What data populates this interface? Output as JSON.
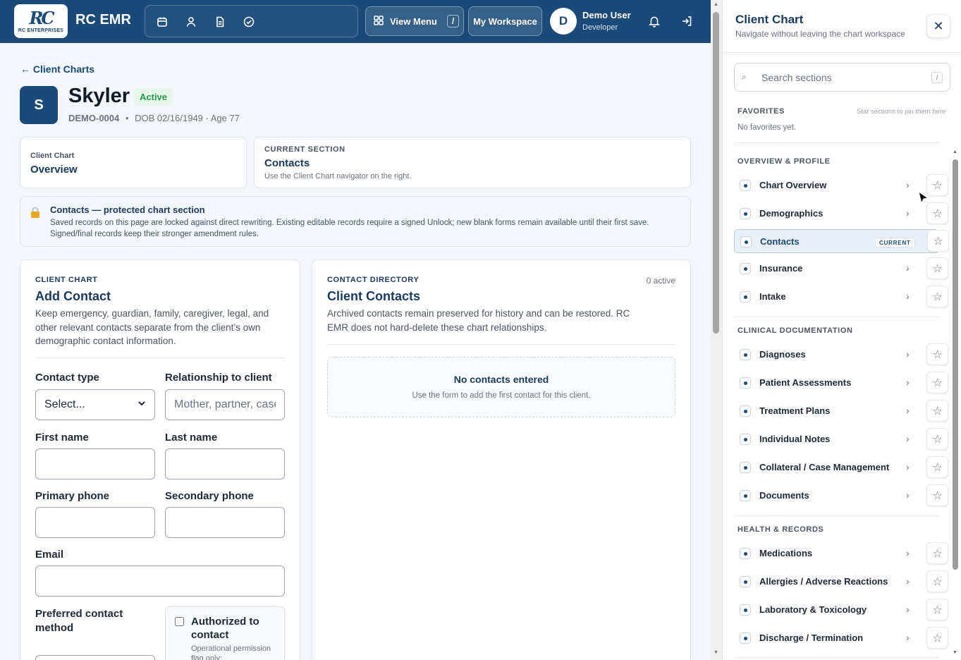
{
  "app": {
    "logo_mark": "RC",
    "logo_sub": "RC ENTERPRISES",
    "title": "RC EMR",
    "quick_icons": [
      "calendar-icon",
      "person-icon",
      "document-icon",
      "check-circle-icon"
    ],
    "view_menu_label": "View Menu",
    "view_menu_shortcut": "/",
    "workspace_label": "My Workspace",
    "user": {
      "initial": "D",
      "name": "Demo User",
      "role": "Developer"
    }
  },
  "client": {
    "back_link": "← Client Charts",
    "initial": "S",
    "name": "Skyler",
    "status": "Active",
    "id": "DEMO-0004",
    "dob_age": "DOB 02/16/1949 · Age 77",
    "separator": "•"
  },
  "chart_card": {
    "label": "Client Chart",
    "value": "Overview"
  },
  "section_card": {
    "label": "CURRENT SECTION",
    "value": "Contacts",
    "hint": "Use the Client Chart navigator on the right."
  },
  "protected": {
    "title": "Contacts — protected chart section",
    "text": "Saved records on this page are locked against direct rewriting. Existing editable records require a signed Unlock; new blank forms remain available until their first save. Signed/final records keep their stronger amendment rules."
  },
  "add_contact": {
    "eyebrow": "CLIENT CHART",
    "title": "Add Contact",
    "description": "Keep emergency, guardian, family, caregiver, legal, and other relevant contacts separate from the client’s own demographic contact information.",
    "fields": {
      "contact_type": {
        "label": "Contact type",
        "value": "Select..."
      },
      "relationship": {
        "label": "Relationship to client",
        "placeholder": "Mother, partner, case manager"
      },
      "first_name": {
        "label": "First name"
      },
      "last_name": {
        "label": "Last name"
      },
      "primary_phone": {
        "label": "Primary phone"
      },
      "secondary_phone": {
        "label": "Secondary phone"
      },
      "email": {
        "label": "Email"
      },
      "preferred_method": {
        "label": "Preferred contact method"
      },
      "authorized": {
        "label": "Authorized to contact",
        "hint": "Operational permission flag only;"
      }
    }
  },
  "directory": {
    "eyebrow": "CONTACT DIRECTORY",
    "title": "Client Contacts",
    "count": "0 active",
    "description": "Archived contacts remain preserved for history and can be restored. RC EMR does not hard-delete these chart relationships.",
    "empty_title": "No contacts entered",
    "empty_text": "Use the form to add the first contact for this client."
  },
  "navigator": {
    "title": "Client Chart",
    "subtitle": "Navigate without leaving the chart workspace",
    "close": "✕",
    "search_placeholder": "Search sections",
    "search_shortcut": "/",
    "favorites_label": "FAVORITES",
    "favorites_hint": "Star sections to pin them here",
    "favorites_empty": "No favorites yet.",
    "current_badge": "CURRENT",
    "groups": [
      {
        "label": "OVERVIEW & PROFILE",
        "items": [
          "Chart Overview",
          "Demographics",
          "Contacts",
          "Insurance",
          "Intake"
        ]
      },
      {
        "label": "CLINICAL DOCUMENTATION",
        "items": [
          "Diagnoses",
          "Patient Assessments",
          "Treatment Plans",
          "Individual Notes",
          "Collateral / Case Management",
          "Documents"
        ]
      },
      {
        "label": "HEALTH & RECORDS",
        "items": [
          "Medications",
          "Allergies / Adverse Reactions",
          "Laboratory & Toxicology",
          "Discharge / Termination"
        ]
      }
    ]
  },
  "colors": {
    "brand": "#1a4a78",
    "active_green": "#1f9d4a",
    "lock": "#d69e2e"
  }
}
